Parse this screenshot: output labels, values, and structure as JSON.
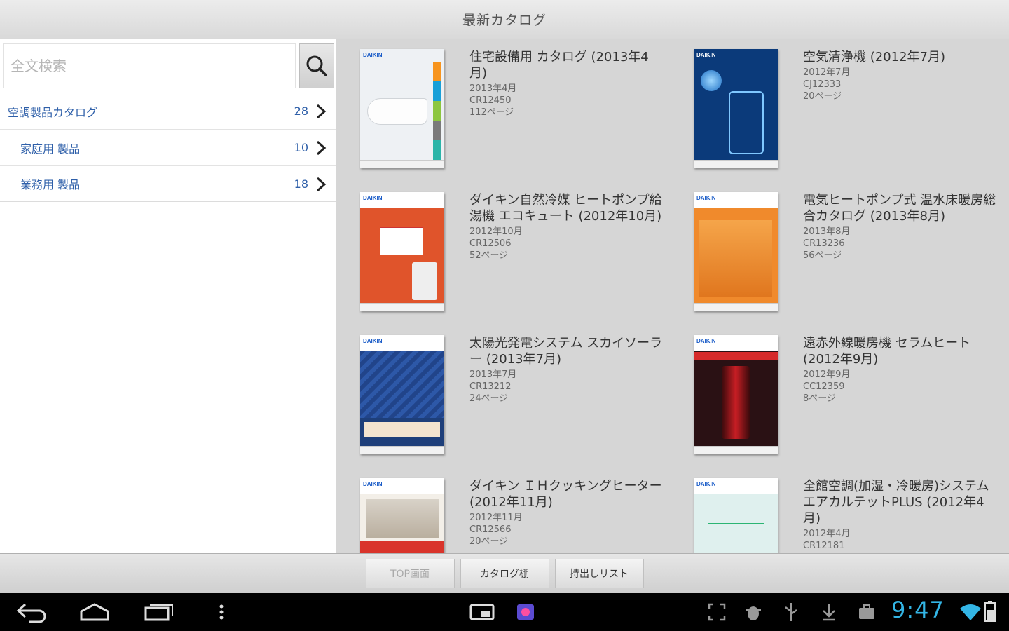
{
  "header": {
    "title": "最新カタログ"
  },
  "search": {
    "placeholder": "全文検索"
  },
  "categories": [
    {
      "label": "空調製品カタログ",
      "count": "28",
      "level": 0
    },
    {
      "label": "家庭用 製品",
      "count": "10",
      "level": 1
    },
    {
      "label": "業務用 製品",
      "count": "18",
      "level": 1
    }
  ],
  "catalogs": [
    {
      "title": "住宅設備用 カタログ (2013年4月)",
      "date": "2013年4月",
      "code": "CR12450",
      "pages": "112ページ",
      "cover_color": "#eef1f4"
    },
    {
      "title": "空気清浄機 (2012年7月)",
      "date": "2012年7月",
      "code": "CJ12333",
      "pages": "20ページ",
      "cover_color": "#0b3a7a"
    },
    {
      "title": "ダイキン自然冷媒 ヒートポンプ給湯機 エコキュート (2012年10月)",
      "date": "2012年10月",
      "code": "CR12506",
      "pages": "52ページ",
      "cover_color": "#e0542b"
    },
    {
      "title": "電気ヒートポンプ式 温水床暖房総合カタログ (2013年8月)",
      "date": "2013年8月",
      "code": "CR13236",
      "pages": "56ページ",
      "cover_color": "#f08a2c"
    },
    {
      "title": "太陽光発電システム スカイソーラー (2013年7月)",
      "date": "2013年7月",
      "code": "CR13212",
      "pages": "24ページ",
      "cover_color": "#1e3f7a"
    },
    {
      "title": "遠赤外線暖房機 セラムヒート (2012年9月)",
      "date": "2012年9月",
      "code": "CC12359",
      "pages": "8ページ",
      "cover_color": "#2a1114"
    },
    {
      "title": "ダイキン ＩＨクッキングヒーター (2012年11月)",
      "date": "2012年11月",
      "code": "CR12566",
      "pages": "20ページ",
      "cover_color": "#f3efe8"
    },
    {
      "title": "全館空調(加湿・冷暖房)システム エアカルテットPLUS (2012年4月)",
      "date": "2012年4月",
      "code": "CR12181",
      "pages": "",
      "cover_color": "#dff0ee"
    }
  ],
  "bottom_buttons": [
    {
      "label": "TOP画面",
      "enabled": false
    },
    {
      "label": "カタログ棚",
      "enabled": true
    },
    {
      "label": "持出しリスト",
      "enabled": true
    }
  ],
  "status": {
    "time": "9:47"
  },
  "brand": {
    "name": "DAIKIN"
  },
  "colors": {
    "accent": "#33b5e5",
    "link": "#2e5fa9"
  }
}
